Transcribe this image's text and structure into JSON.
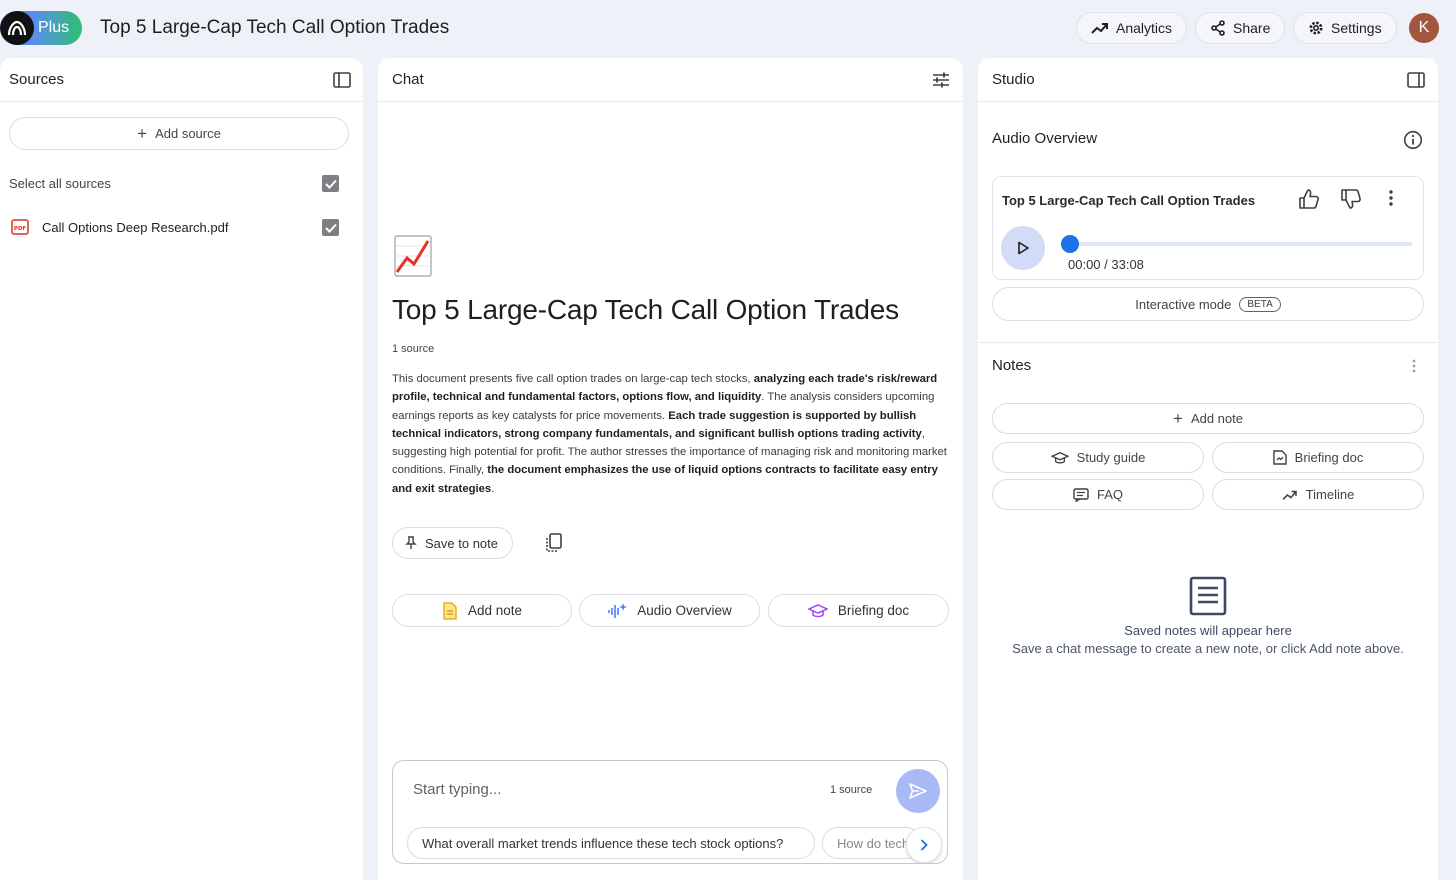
{
  "app": {
    "logo_text": "Plus",
    "notebook_title": "Top 5 Large-Cap Tech Call Option Trades",
    "avatar_letter": "K"
  },
  "topbar": {
    "analytics_label": "Analytics",
    "share_label": "Share",
    "settings_label": "Settings"
  },
  "sources": {
    "title": "Sources",
    "add_source_label": "Add source",
    "select_all_label": "Select all sources",
    "select_all_checked": true,
    "items": [
      {
        "name": "Call Options Deep Research.pdf",
        "type": "pdf",
        "checked": true
      }
    ]
  },
  "chat": {
    "title": "Chat",
    "doc_title": "Top 5 Large-Cap Tech Call Option Trades",
    "source_count": "1 source",
    "summary": [
      {
        "text": "This document presents five call option trades on large-cap tech stocks, ",
        "bold": false
      },
      {
        "text": "analyzing each trade's risk/reward profile, technical and fundamental factors, options flow, and liquidity",
        "bold": true
      },
      {
        "text": ". The analysis considers upcoming earnings reports as key catalysts for price movements. ",
        "bold": false
      },
      {
        "text": "Each trade suggestion is supported by bullish technical indicators, strong company fundamentals, and significant bullish options trading activity",
        "bold": true
      },
      {
        "text": ", suggesting high potential for profit. The author stresses the importance of managing risk and monitoring market conditions. Finally, ",
        "bold": false
      },
      {
        "text": "the document emphasizes the use of liquid options contracts to facilitate easy entry and exit strategies",
        "bold": true
      },
      {
        "text": ".",
        "bold": false
      }
    ],
    "save_to_note_label": "Save to note",
    "chips": {
      "add_note": "Add note",
      "audio_overview": "Audio Overview",
      "briefing_doc": "Briefing doc"
    },
    "input": {
      "placeholder": "Start typing...",
      "source_count": "1 source"
    },
    "suggestions": [
      "What overall market trends influence these tech stock options?",
      "How do tech"
    ]
  },
  "studio": {
    "title": "Studio",
    "audio_overview": {
      "heading": "Audio Overview",
      "card_title": "Top 5 Large-Cap Tech Call Option Trades",
      "time_display": "00:00 / 33:08",
      "progress_fraction": 0.0,
      "interactive_label": "Interactive mode",
      "beta_label": "BETA"
    },
    "notes": {
      "heading": "Notes",
      "add_note_label": "Add note",
      "study_guide_label": "Study guide",
      "briefing_doc_label": "Briefing doc",
      "faq_label": "FAQ",
      "timeline_label": "Timeline",
      "empty_title": "Saved notes will appear here",
      "empty_subtitle": "Save a chat message to create a new note, or click Add note above."
    }
  },
  "colors": {
    "accent": "#1a73e8",
    "send_button": "#a8b9f5",
    "play_button": "#d3dcf6",
    "background": "#eef1f7",
    "avatar": "#a0563f"
  },
  "icons": {
    "analytics": "trend-up-icon",
    "share": "share-icon",
    "settings": "gear-icon",
    "sources_panel_toggle": "panel-left-icon",
    "chat_settings": "tune-icon",
    "studio_panel_toggle": "panel-right-icon",
    "info": "info-icon",
    "thumb_up": "thumb-up-icon",
    "thumb_down": "thumb-down-icon",
    "play": "play-icon",
    "send": "send-icon",
    "copy": "copy-icon",
    "pin": "pin-icon",
    "pdf": "pdf-icon"
  }
}
